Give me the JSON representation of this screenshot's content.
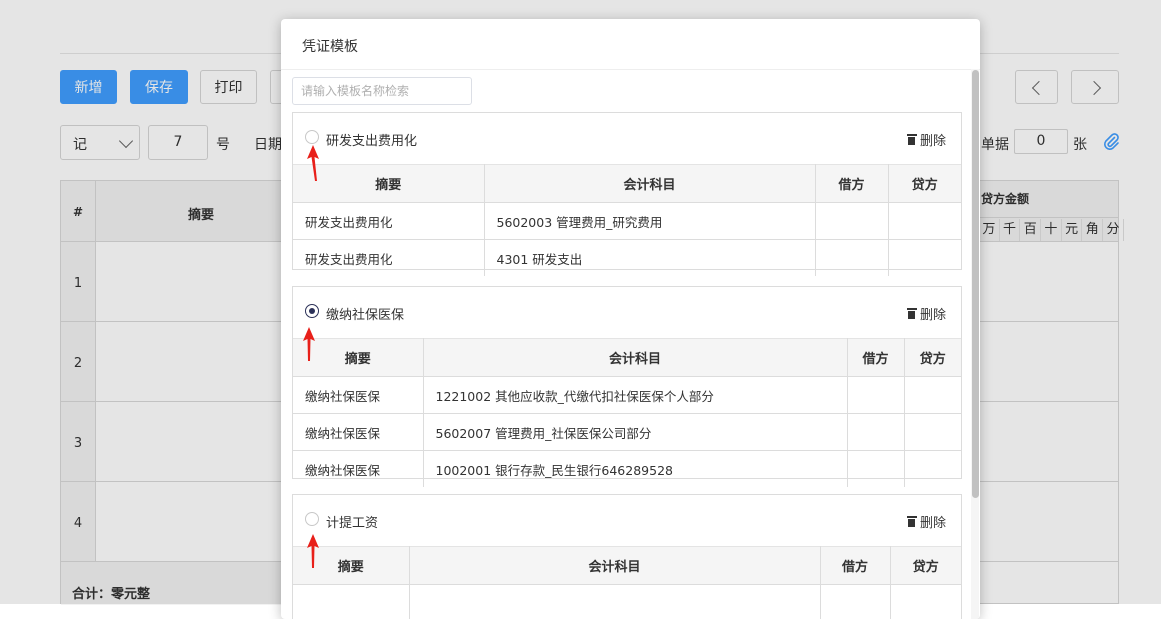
{
  "toolbar": {
    "new_label": "新增",
    "save_label": "保存",
    "print_label": "打印"
  },
  "voucher": {
    "word": "记",
    "number": "7",
    "number_suffix": "号",
    "date_label": "日期",
    "attachment_label": "单据",
    "attachment_count": "0",
    "attachment_unit": "张"
  },
  "table": {
    "col_index": "#",
    "col_summary": "摘要",
    "credit_header": "贷方金额",
    "digits": [
      "万",
      "千",
      "百",
      "十",
      "元",
      "角",
      "分"
    ],
    "rows": [
      "1",
      "2",
      "3",
      "4"
    ],
    "total_label": "合计：零元整"
  },
  "modal": {
    "title": "凭证模板",
    "search_placeholder": "请输入模板名称检索",
    "delete_label": "删除",
    "headers": {
      "summary": "摘要",
      "account": "会计科目",
      "debit": "借方",
      "credit": "贷方"
    },
    "templates": [
      {
        "name": "研发支出费用化",
        "selected": false,
        "rows": [
          {
            "summary": "研发支出费用化",
            "account": "5602003 管理费用_研究费用",
            "debit": "",
            "credit": ""
          },
          {
            "summary": "研发支出费用化",
            "account": "4301 研发支出",
            "debit": "",
            "credit": ""
          }
        ]
      },
      {
        "name": "缴纳社保医保",
        "selected": true,
        "rows": [
          {
            "summary": "缴纳社保医保",
            "account": "1221002 其他应收款_代缴代扣社保医保个人部分",
            "debit": "",
            "credit": ""
          },
          {
            "summary": "缴纳社保医保",
            "account": "5602007 管理费用_社保医保公司部分",
            "debit": "",
            "credit": ""
          },
          {
            "summary": "缴纳社保医保",
            "account": "1002001 银行存款_民生银行646289528",
            "debit": "",
            "credit": ""
          }
        ]
      },
      {
        "name": "计提工资",
        "selected": false,
        "rows": []
      }
    ]
  },
  "colors": {
    "primary": "#409eff",
    "radio_checked": "#2c3158",
    "annotation_arrow": "#e8201a"
  }
}
